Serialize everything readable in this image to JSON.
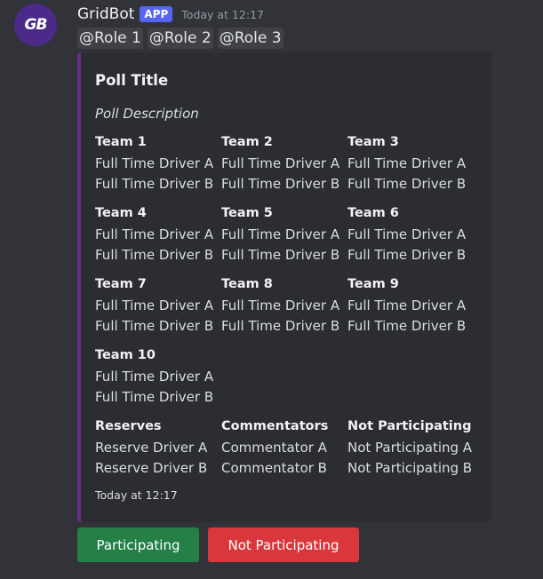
{
  "message": {
    "avatar_text": "GB",
    "username": "GridBot",
    "badge": "APP",
    "timestamp": "Today at 12:17",
    "mentions": [
      "@Role 1",
      "@Role 2",
      "@Role 3"
    ]
  },
  "embed": {
    "accent_color": "#6a2c8f",
    "title": "Poll Title",
    "description": "Poll Description",
    "fields": [
      {
        "name": "Team 1",
        "values": [
          "Full Time Driver A",
          "Full Time Driver B"
        ]
      },
      {
        "name": "Team 2",
        "values": [
          "Full Time Driver A",
          "Full Time Driver B"
        ]
      },
      {
        "name": "Team 3",
        "values": [
          "Full Time Driver A",
          "Full Time Driver B"
        ]
      },
      {
        "name": "Team 4",
        "values": [
          "Full Time Driver A",
          "Full Time Driver B"
        ]
      },
      {
        "name": "Team 5",
        "values": [
          "Full Time Driver A",
          "Full Time Driver B"
        ]
      },
      {
        "name": "Team 6",
        "values": [
          "Full Time Driver A",
          "Full Time Driver B"
        ]
      },
      {
        "name": "Team 7",
        "values": [
          "Full Time Driver A",
          "Full Time Driver B"
        ]
      },
      {
        "name": "Team 8",
        "values": [
          "Full Time Driver A",
          "Full Time Driver B"
        ]
      },
      {
        "name": "Team 9",
        "values": [
          "Full Time Driver A",
          "Full Time Driver B"
        ]
      },
      {
        "name": "Team 10",
        "values": [
          "Full Time Driver A",
          "Full Time Driver B"
        ]
      },
      {
        "name": "Reserves",
        "values": [
          "Reserve Driver A",
          "Reserve Driver B"
        ]
      },
      {
        "name": "Commentators",
        "values": [
          "Commentator A",
          "Commentator B"
        ]
      },
      {
        "name": "Not Participating",
        "values": [
          "Not Participating A",
          "Not Participating B"
        ]
      }
    ],
    "footer_timestamp": "Today at 12:17"
  },
  "buttons": {
    "participating": "Participating",
    "not_participating": "Not Participating"
  }
}
